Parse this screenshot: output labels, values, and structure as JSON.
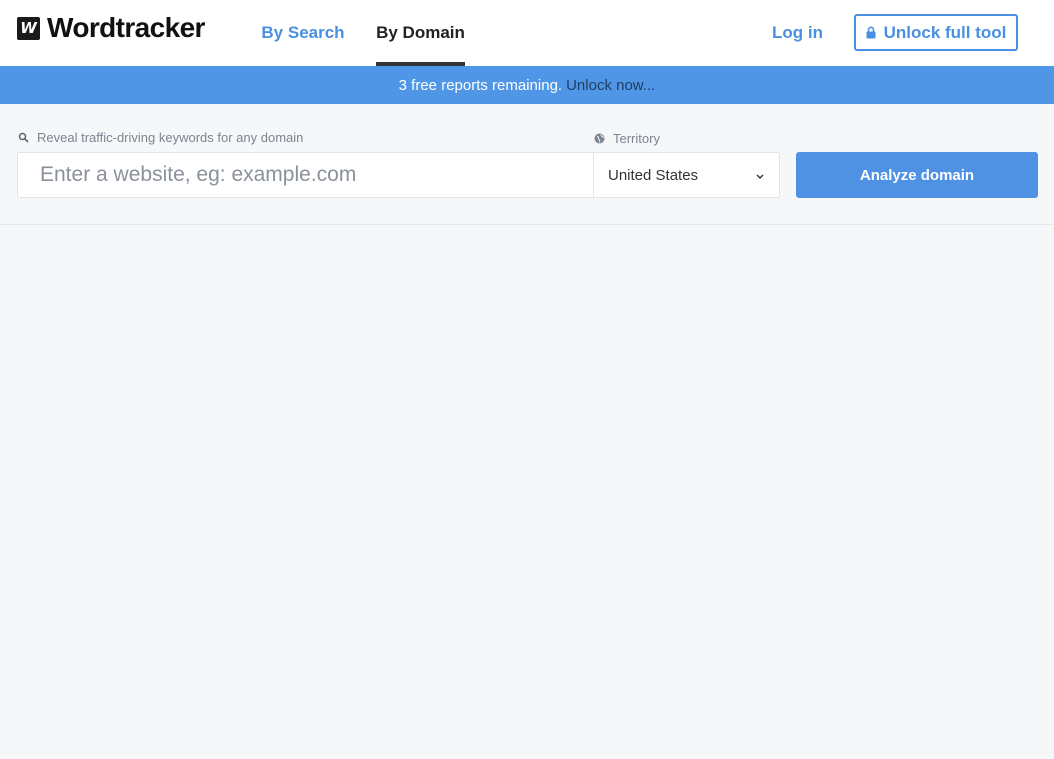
{
  "header": {
    "logo_mark": "W",
    "logo_text": "Wordtracker",
    "tabs": [
      {
        "label": "By Search"
      },
      {
        "label": "By Domain"
      }
    ],
    "login_label": "Log in",
    "unlock_label": "Unlock full tool"
  },
  "banner": {
    "message": "3 free reports remaining.",
    "link": "Unlock now..."
  },
  "search": {
    "hint": "Reveal traffic-driving keywords for any domain",
    "placeholder": "Enter a website, eg: example.com",
    "territory_label": "Territory",
    "territory_value": "United States",
    "analyze_label": "Analyze domain"
  },
  "colors": {
    "accent": "#4a90e2",
    "banner": "#5096e6",
    "background": "#f6f7f9"
  },
  "icons": {
    "lock": "lock-icon",
    "search": "search-icon",
    "globe": "globe-icon",
    "chevron": "chevron-down-icon"
  }
}
